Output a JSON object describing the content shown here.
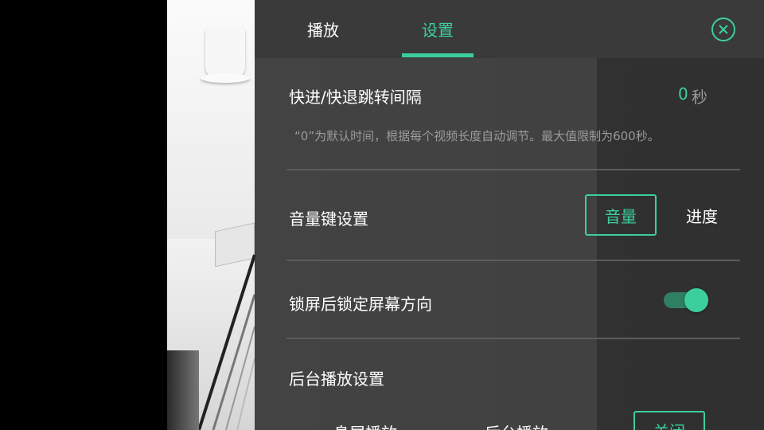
{
  "tabs": {
    "play": "播放",
    "settings": "设置",
    "active": "settings"
  },
  "seek": {
    "title": "快进/快退跳转间隔",
    "value": "0",
    "unit": "秒",
    "hint": "“0”为默认时间，根据每个视频长度自动调节。最大值限制为600秒。"
  },
  "volume_key": {
    "title": "音量键设置",
    "options": [
      "音量",
      "进度"
    ],
    "selected": "音量"
  },
  "lock_orientation": {
    "title": "锁屏后锁定屏幕方向",
    "enabled": true
  },
  "background_play": {
    "title": "后台播放设置",
    "options": [
      "息屏播放",
      "后台播放",
      "关闭"
    ],
    "selected": "关闭"
  },
  "icons": {
    "close": "close-circle-icon"
  },
  "colors": {
    "accent": "#3ccf9e",
    "panel": "#303030",
    "text": "#ffffff",
    "hint": "#9b9b9b"
  }
}
